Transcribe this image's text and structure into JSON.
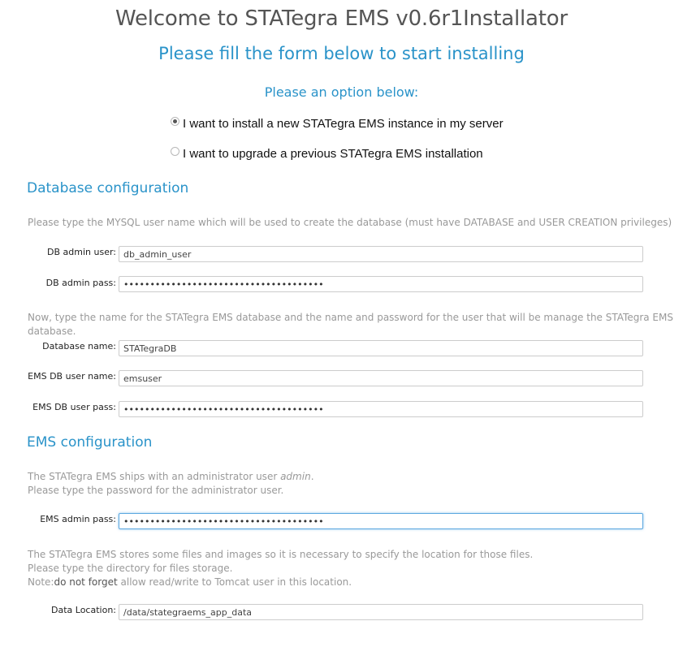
{
  "header": {
    "title": "Welcome to STATegra EMS v0.6r1Installator",
    "subtitle": "Please fill the form below to start installing",
    "option_heading": "Please an option below:"
  },
  "options": [
    {
      "label": "I want to install a new STATegra EMS instance in my server",
      "checked": true
    },
    {
      "label": "I want to upgrade a previous STATegra EMS installation",
      "checked": false
    }
  ],
  "database_config": {
    "title": "Database configuration",
    "help1": "Please type the MYSQL user name which will be used to create the database (must have DATABASE and USER CREATION privileges)",
    "db_admin_user": {
      "label": "DB admin user:",
      "value": "db_admin_user"
    },
    "db_admin_pass": {
      "label": "DB admin pass:",
      "value": "••••••••••••••••••••••••••••••••••••••"
    },
    "help2": "Now, type the name for the STATegra EMS database and the name and password for the user that will be manage the STATegra EMS database.",
    "database_name": {
      "label": "Database name:",
      "value": "STATegraDB"
    },
    "ems_db_user_name": {
      "label": "EMS DB user name:",
      "value": "emsuser"
    },
    "ems_db_user_pass": {
      "label": "EMS DB user pass:",
      "value": "••••••••••••••••••••••••••••••••••••••"
    }
  },
  "ems_config": {
    "title": "EMS configuration",
    "help1_prefix": "The STATegra EMS ships with an administrator user ",
    "help1_admin": "admin",
    "help1_suffix": ".",
    "help2": "Please type the password for the administrator user.",
    "ems_admin_pass": {
      "label": "EMS admin pass:",
      "value": "••••••••••••••••••••••••••••••••••••••"
    },
    "help3": "The STATegra EMS stores some files and images so it is necessary to specify the location for those files.",
    "help4": "Please type the directory for files storage.",
    "help5_prefix": "Note:",
    "help5_bold": "do not forget",
    "help5_suffix": " allow read/write to Tomcat user in this location.",
    "data_location": {
      "label": "Data Location:",
      "value": "/data/stategraems_app_data"
    }
  },
  "colors": {
    "accent": "#2a93c9",
    "help_text": "#999999",
    "focus_border": "#5aa7e0"
  }
}
